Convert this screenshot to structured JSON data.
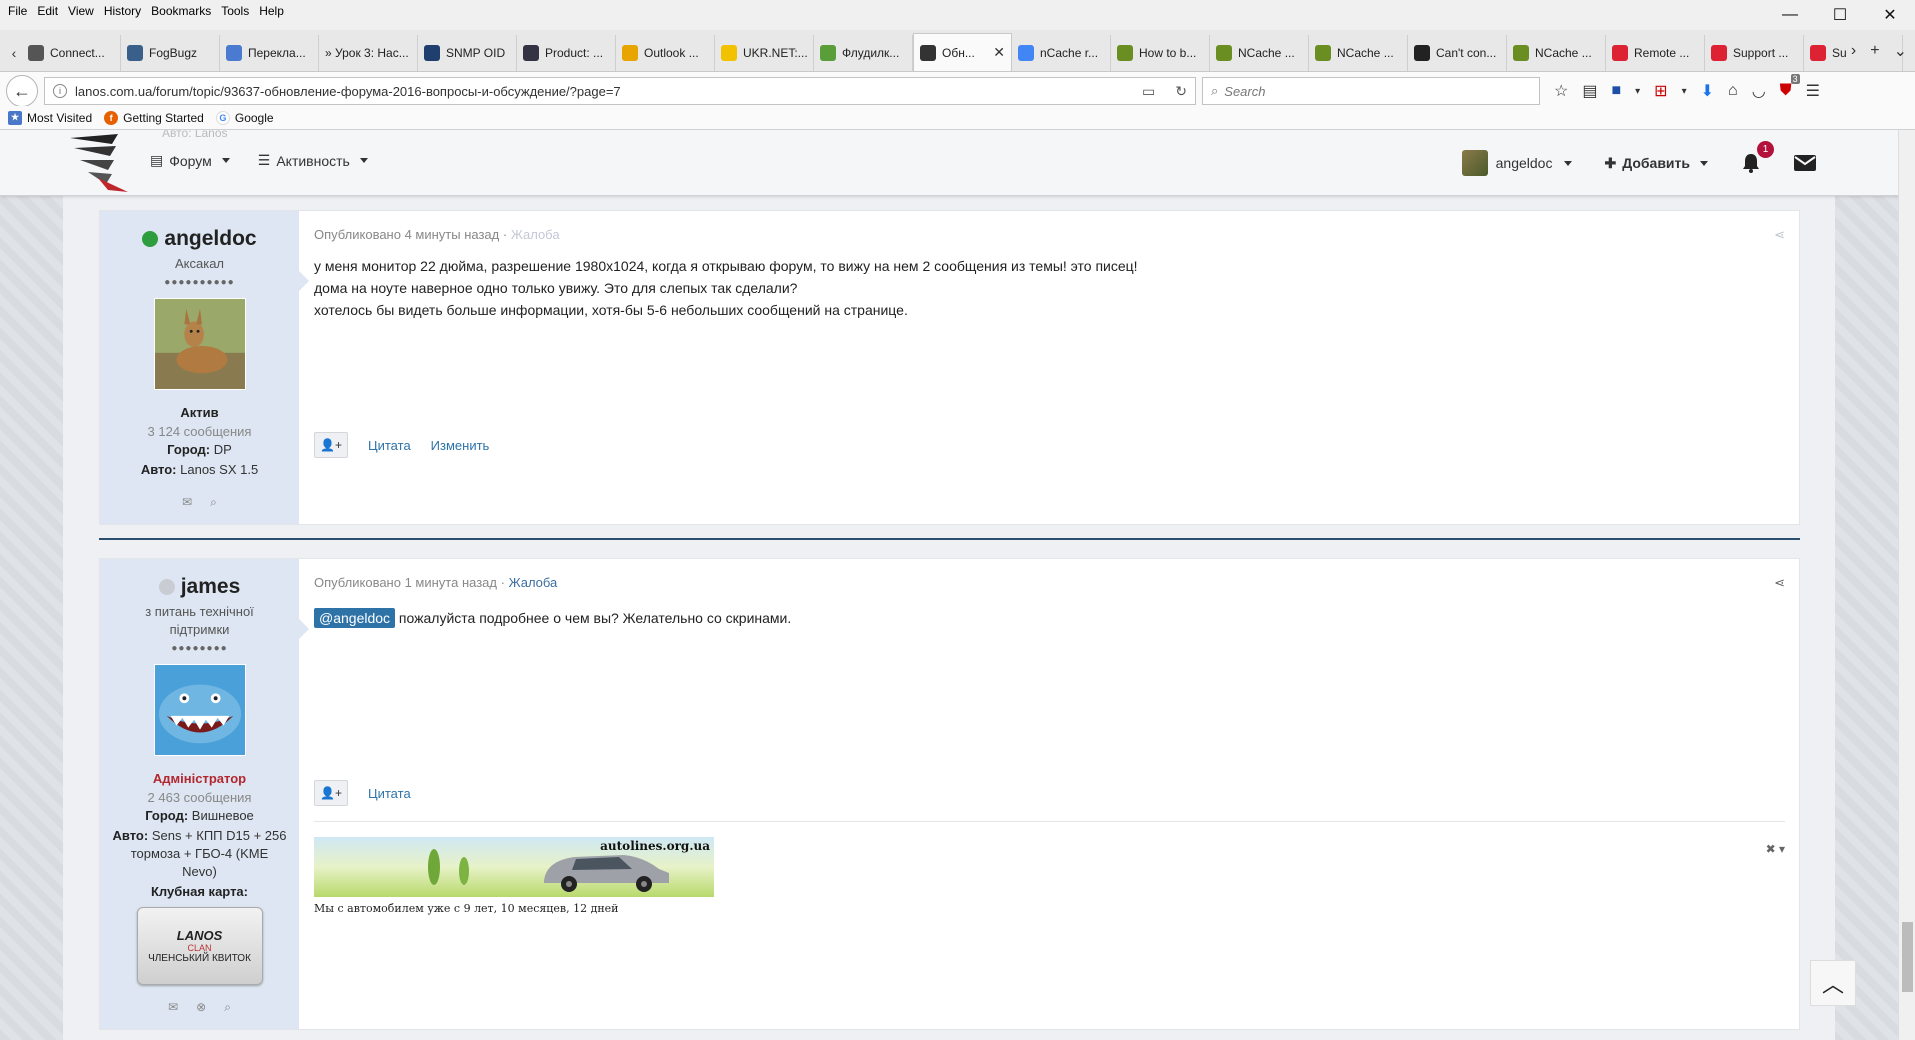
{
  "menu": [
    "File",
    "Edit",
    "View",
    "History",
    "Bookmarks",
    "Tools",
    "Help"
  ],
  "window_controls": [
    "—",
    "☐",
    "✕"
  ],
  "tabs": [
    {
      "label": "Connect...",
      "icon": "circle-icon",
      "color": "#555"
    },
    {
      "label": "FogBugz",
      "icon": "fogbugz-icon",
      "color": "#3a5f8a"
    },
    {
      "label": "Перекла...",
      "icon": "translate-icon",
      "color": "#4a7bd0"
    },
    {
      "label": "» Урок 3: Нас...",
      "icon": "",
      "color": ""
    },
    {
      "label": "SNMP OID",
      "icon": "snmp-icon",
      "color": "#1f3f6e"
    },
    {
      "label": "Product: ...",
      "icon": "product-icon",
      "color": "#334"
    },
    {
      "label": "Outlook ...",
      "icon": "outlook-icon",
      "color": "#e8a400"
    },
    {
      "label": "UKR.NET:...",
      "icon": "ukrnet-icon",
      "color": "#f2c200"
    },
    {
      "label": "Флудилк...",
      "icon": "mail-icon",
      "color": "#5a9e3a"
    },
    {
      "label": "Обн...",
      "icon": "forum-icon",
      "color": "#333",
      "active": true
    },
    {
      "label": "nCache r...",
      "icon": "google-icon",
      "color": "#4285f4"
    },
    {
      "label": "How to b...",
      "icon": "puzzle-icon",
      "color": "#6b8e23"
    },
    {
      "label": "NCache ...",
      "icon": "puzzle-icon",
      "color": "#6b8e23"
    },
    {
      "label": "NCache ...",
      "icon": "puzzle-icon",
      "color": "#6b8e23"
    },
    {
      "label": "Can't con...",
      "icon": "github-icon",
      "color": "#222"
    },
    {
      "label": "NCache ...",
      "icon": "puzzle-icon",
      "color": "#6b8e23"
    },
    {
      "label": "Remote ...",
      "icon": "support-icon",
      "color": "#d23"
    },
    {
      "label": "Support ...",
      "icon": "support-icon",
      "color": "#d23"
    },
    {
      "label": "Su",
      "icon": "support-icon",
      "color": "#d23"
    }
  ],
  "address": {
    "url": "lanos.com.ua/forum/topic/93637-обновление-форума-2016-вопросы-и-обсуждение/?page=7",
    "search_placeholder": "Search"
  },
  "toolbar_badge": "3",
  "bookmarks": [
    {
      "label": "Most Visited",
      "color": "#4a78c8"
    },
    {
      "label": "Getting Started",
      "color": "#e66000"
    },
    {
      "label": "Google",
      "color": "#4285f4"
    }
  ],
  "site_header": {
    "nav": [
      "Форум",
      "Активность"
    ],
    "partial_text": "Авто: Lanos",
    "user": "angeldoc",
    "add_label": "Добавить",
    "notifications": "1"
  },
  "posts": [
    {
      "author": "angeldoc",
      "online": true,
      "title": "Аксакал",
      "pips": "●●●●●●●●●●",
      "rank": "Актив",
      "count": "3 124 сообщения",
      "city_label": "Город:",
      "city": "DP",
      "auto_label": "Авто:",
      "auto": "Lanos SX 1.5",
      "meta": "Опубликовано 4 минуты назад ·",
      "report": "Жалоба",
      "lines": [
        "у меня монитор 22 дюйма, разрешение 1980x1024, когда я открываю форум, то вижу на нем 2 сообщения из темы! это писец!",
        "дома на ноуте наверное одно только увижу.  Это для слепых так сделали?",
        "хотелось бы видеть больше информации, хотя-бы 5-6 небольших сообщений на странице."
      ],
      "actions": [
        "Цитата",
        "Изменить"
      ]
    },
    {
      "author": "james",
      "online": false,
      "title": "з питань технічної підтримки",
      "pips": "●●●●●●●●",
      "rank": "Адміністратор",
      "count": "2 463 сообщения",
      "city_label": "Город:",
      "city": "Вишневое",
      "auto_label": "Авто:",
      "auto": "Sens + КПП D15 + 256 тормоза + ГБО-4 (KME Nevo)",
      "club_label": "Клубная карта:",
      "club_card": {
        "brand": "LANOS",
        "sub": "CLAN",
        "text": "ЧЛЕНСЬКИЙ КВИТОК"
      },
      "meta": "Опубликовано 1 минута назад ·",
      "report": "Жалоба",
      "mention": "@angeldoc",
      "text": " пожалуйста подробнее о чем вы? Желательно со скринами.",
      "actions": [
        "Цитата"
      ],
      "signature": {
        "site": "autolines.org.ua",
        "text": "Мы с автомобилем уже с 9 лет, 10 месяцев, 12 дней"
      }
    }
  ]
}
